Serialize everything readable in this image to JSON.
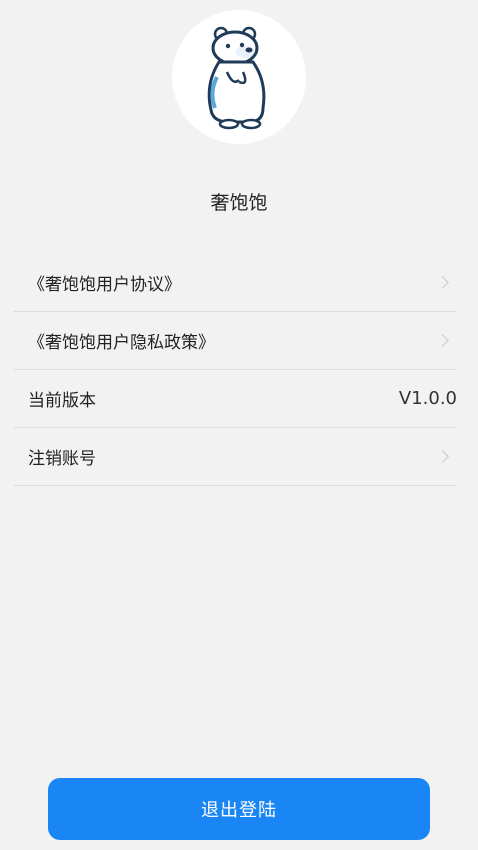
{
  "app": {
    "name": "奢饱饱",
    "logo_icon": "polar-bear-logo-icon"
  },
  "menu": {
    "items": [
      {
        "label": "《奢饱饱用户协议》",
        "icon": "chevron-right-icon"
      },
      {
        "label": "《奢饱饱用户隐私政策》",
        "icon": "chevron-right-icon"
      },
      {
        "label": "当前版本",
        "value": "V1.0.0"
      },
      {
        "label": "注销账号",
        "icon": "chevron-right-icon"
      }
    ]
  },
  "logout": {
    "label": "退出登陆"
  },
  "colors": {
    "accent": "#1a86f5",
    "background": "#f2f2f2"
  }
}
